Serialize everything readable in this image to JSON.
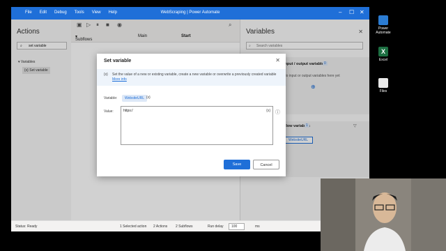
{
  "window": {
    "title": "WebScraping | Power Automate",
    "menu": [
      "File",
      "Edit",
      "Debug",
      "Tools",
      "View",
      "Help"
    ]
  },
  "actions_pane": {
    "title": "Actions",
    "search_value": "set variable",
    "group": "Variables",
    "item": "Set variable"
  },
  "toolbar": {
    "subflows_label": "Subflows"
  },
  "tabs": {
    "main": "Main",
    "start": "Start"
  },
  "variables_pane": {
    "title": "Variables",
    "search_placeholder": "Search variables",
    "input_output_title": "Input / output variables",
    "input_output_count": "0",
    "input_output_hint": "No input or output variables here yet",
    "flow_variables_title": "Flow variables",
    "flow_variables_count": "1",
    "variable_name": "WebsiteURL"
  },
  "dialog": {
    "title": "Set variable",
    "description": "Set the value of a new or existing variable, create a new variable or overwrite a previously created variable",
    "more_info": "More info",
    "variable_label": "Variable:",
    "variable_name": "WebsiteURL",
    "value_label": "Value:",
    "value": "https:/",
    "fx": "{x}",
    "save": "Save",
    "cancel": "Cancel"
  },
  "status_bar": {
    "status": "Status: Ready",
    "selected": "1 Selected action",
    "actions": "2 Actions",
    "subflows": "2 Subflows",
    "run_delay_label": "Run delay",
    "run_delay_value": "100",
    "unit": "ms"
  },
  "desktop": [
    {
      "label": "Power Automate",
      "color": "#2b7cd3"
    },
    {
      "label": "Excel",
      "color": "#1d6f42"
    },
    {
      "label": "Files",
      "color": "#e8e8e8"
    }
  ]
}
